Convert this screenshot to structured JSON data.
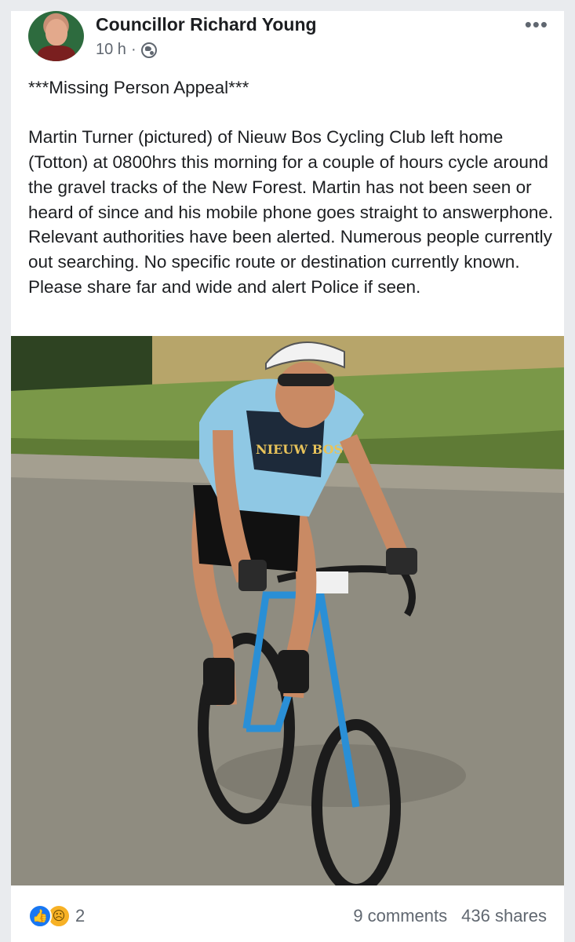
{
  "post": {
    "author": "Councillor Richard Young",
    "time": "10 h",
    "separator": "·",
    "privacy_icon": "globe-icon",
    "more_label": "•••",
    "heading": "***Missing Person Appeal***",
    "body": "Martin Turner (pictured) of Nieuw Bos Cycling Club left home (Totton) at 0800hrs this morning for a couple of hours cycle around the gravel tracks of the New Forest. Martin has not been seen or heard of since and his mobile phone goes straight to answerphone. Relevant authorities have been alerted. Numerous people currently out searching. No specific route or destination currently known. Please share far and wide and alert Police if seen."
  },
  "photo": {
    "jersey_text": "NIEUW BOS",
    "colors": {
      "jersey": "#8fc8e4",
      "road": "#8d8a7e",
      "grass": "#6a8a3a",
      "frame": "#2a8fd6"
    }
  },
  "footer": {
    "reaction_icons": [
      "like-icon",
      "sad-icon"
    ],
    "reaction_count": "2",
    "comments": "9 comments",
    "shares": "436 shares"
  },
  "theme": {
    "page_bg": "#e9ebee",
    "card_bg": "#ffffff",
    "text": "#1c1e21",
    "secondary_text": "#606770",
    "like_blue": "#1877f2"
  }
}
